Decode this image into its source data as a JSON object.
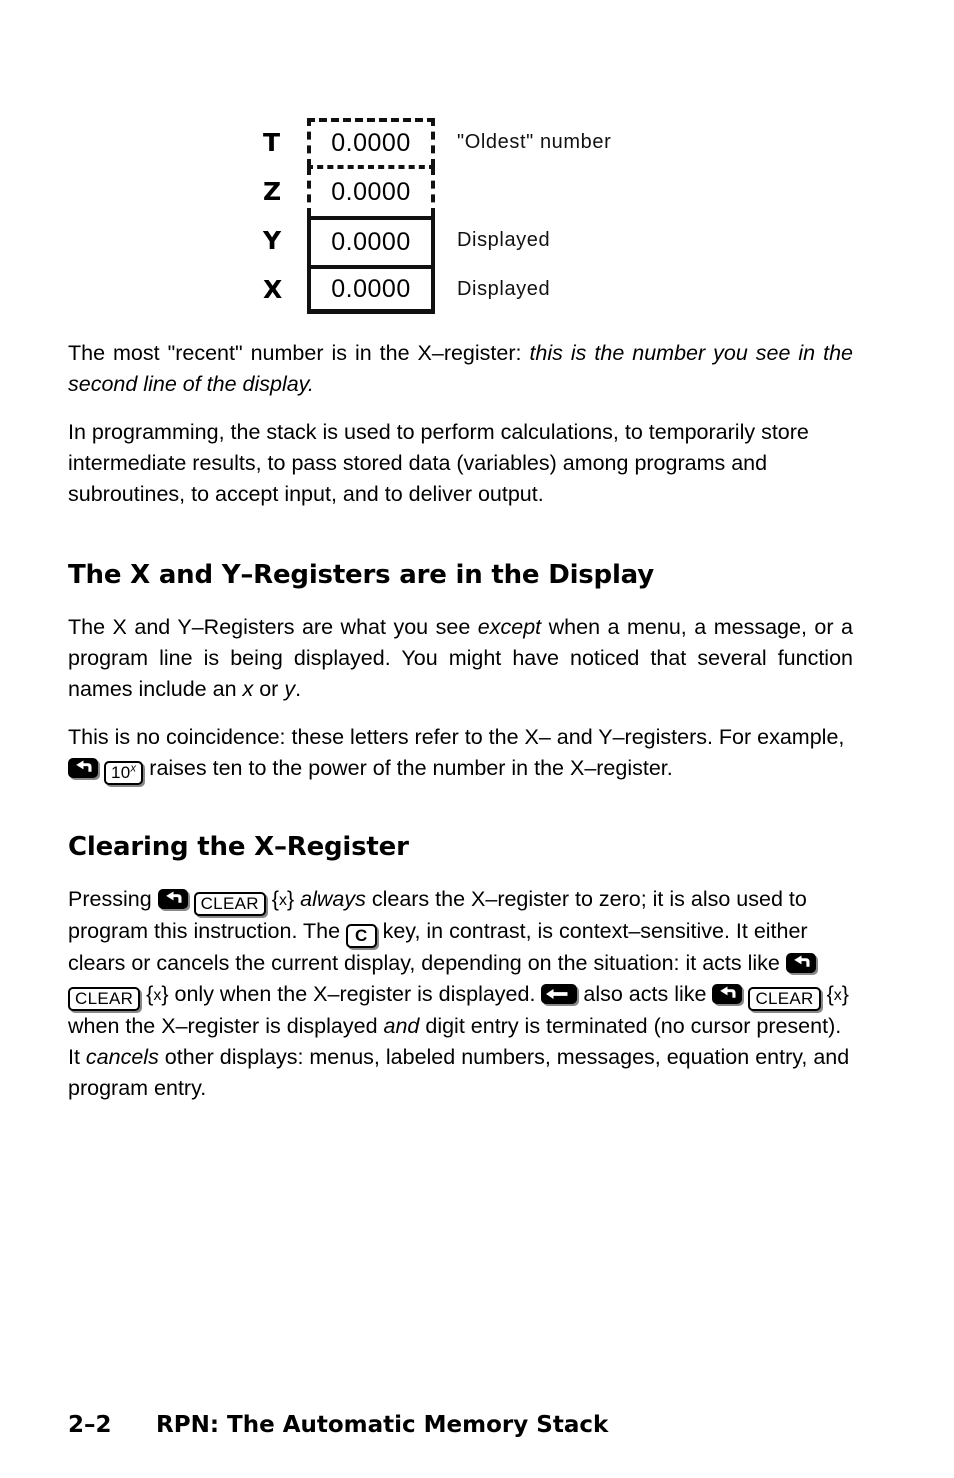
{
  "figure": {
    "name": "rpn-stack-diagram",
    "rows": [
      {
        "register": "T",
        "value": "0.0000",
        "note": "\"Oldest\"  number",
        "border": "dashed"
      },
      {
        "register": "Z",
        "value": "0.0000",
        "note": "",
        "border": "dashed"
      },
      {
        "register": "Y",
        "value": "0.0000",
        "note": "Displayed",
        "border": "solid"
      },
      {
        "register": "X",
        "value": "0.0000",
        "note": "Displayed",
        "border": "solid"
      }
    ]
  },
  "paragraphs": {
    "p1_a": "The most \"recent\" number is in the X–register: ",
    "p1_italic": "this is the number you see in the second line of the display.",
    "p2": "In programming, the stack is used to perform calculations, to temporarily store intermediate results, to pass stored data (variables) among programs and subroutines, to accept input, and to deliver output."
  },
  "section1": {
    "heading": "The X and Y–Registers are in the Display",
    "p1_a": "The X and Y–Registers are what you see ",
    "p1_italic": "except",
    "p1_b": " when a menu, a message, or a program line is being displayed. You might have noticed that several function names include an ",
    "p1_italic2": "x",
    "p1_c": " or ",
    "p1_italic3": "y",
    "p1_d": ".",
    "p2_a": "This is no coincidence: these letters refer to the X– and Y–registers. For example, ",
    "p2_key_shift": "shift-key-icon",
    "p2_key_pow_base": "10",
    "p2_key_pow_exp": "x",
    "p2_b": " raises ten to the power of the number in the X–register."
  },
  "section2": {
    "heading": "Clearing the X–Register",
    "t1": "Pressing ",
    "key_shift": "shift-key-icon",
    "key_clear": "CLEAR",
    "brace_x": "{x}",
    "t2": " ",
    "it_always": "always",
    "t3": " clears the X–register to zero; it is also used to program this instruction. The ",
    "key_c": "C",
    "t4": " key, in contrast, is context–sensitive. It either clears or cancels the current display, depending on the situation: it acts like ",
    "t5": " only when the X–register is displayed. ",
    "key_backspace": "backspace-key-icon",
    "t6": " also acts like ",
    "t7": " when the X–register is displayed ",
    "it_and": "and",
    "t8": " digit entry is terminated (no cursor present). It ",
    "it_cancels": "cancels",
    "t9": " other displays: menus, labeled numbers, messages, equation entry, and program entry."
  },
  "footer": {
    "page_number": "2–2",
    "running_title": "RPN: The Automatic Memory Stack"
  }
}
